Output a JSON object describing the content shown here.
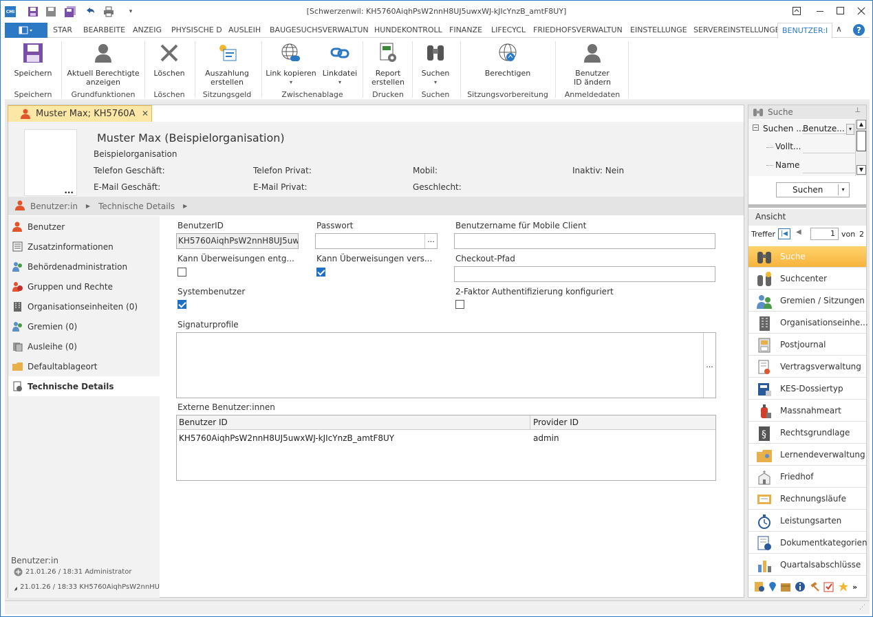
{
  "app": {
    "window_title": "[Schwerzenwil: KH5760AiqhPsW2nnH8UJ5uwxWJ-kJIcYnzB_amtF8UY]",
    "logo": "CMI"
  },
  "ribbon_tabs": [
    "STAR",
    "BEARBEITE",
    "ANZEIG",
    "PHYSISCHE D",
    "AUSLEIH",
    "BAUGESUCHSVERWALTUN",
    "HUNDEKONTROLL",
    "FINANZE",
    "LIFECYCL",
    "FRIEDHOFSVERWALTUN",
    "EINSTELLUNGE",
    "SERVEREINSTELLUNGE"
  ],
  "ribbon_active_tab": "BENUTZER:I",
  "ribbon": {
    "speichern": "Speichern",
    "aktuell_1": "Aktuell Berechtigte",
    "aktuell_2": "anzeigen",
    "loeschen": "Löschen",
    "auszahlung_1": "Auszahlung",
    "auszahlung_2": "erstellen",
    "link_kopieren": "Link kopieren",
    "linkdatei": "Linkdatei",
    "report_1": "Report",
    "report_2": "erstellen",
    "suchen": "Suchen",
    "berechtigen": "Berechtigen",
    "benutzer_1": "Benutzer",
    "benutzer_2": "ID ändern",
    "groups": {
      "speichern": "Speichern",
      "grundfunktionen": "Grundfunktionen",
      "loeschen": "Löschen",
      "sitzungsgeld": "Sitzungsgeld",
      "zwischenablage": "Zwischenablage",
      "drucken": "Drucken",
      "suchen": "Suchen",
      "sitzungsvorbereitung": "Sitzungsvorbereitung",
      "anmeldedaten": "Anmeldedaten"
    }
  },
  "doc_tab": "Muster Max; KH5760A",
  "header": {
    "name": "Muster Max (Beispielorganisation)",
    "org": "Beispielorganisation",
    "telefon_geschaeft": "Telefon Geschäft:",
    "telefon_privat": "Telefon Privat:",
    "mobil": "Mobil:",
    "inaktiv": "Inaktiv: Nein",
    "email_geschaeft": "E-Mail Geschäft:",
    "email_privat": "E-Mail Privat:",
    "geschlecht": "Geschlecht:"
  },
  "breadcrumb": [
    "Benutzer:in",
    "Technische Details"
  ],
  "nav": [
    "Benutzer",
    "Zusatzinformationen",
    "Behördenadministration",
    "Gruppen und Rechte",
    "Organisationseinheiten (0)",
    "Gremien (0)",
    "Ausleihe (0)",
    "Defaultablageort",
    "Technische Details"
  ],
  "nav_footer": {
    "title": "Benutzer:in",
    "created": "21.01.26 / 18:31 Administrator",
    "modified": "21.01.26 / 18:33 KH5760AiqhPsW2nnHU"
  },
  "form": {
    "benutzerid_label": "BenutzerID",
    "benutzerid_value": "KH5760AiqhPsW2nnH8UJ5uw:",
    "passwort_label": "Passwort",
    "mobile_label": "Benutzername für Mobile Client",
    "kann_entg_label": "Kann Überweisungen entg...",
    "kann_vers_label": "Kann Überweisungen vers...",
    "checkout_label": "Checkout-Pfad",
    "systembenutzer_label": "Systembenutzer",
    "twofa_label": "2-Faktor Authentifizierung konfiguriert",
    "signatur_label": "Signaturprofile",
    "extern_label": "Externe Benutzer:innen",
    "col_benutzer_id": "Benutzer ID",
    "col_provider_id": "Provider ID",
    "row_benutzer_id": "KH5760AiqhPsW2nnH8UJ5uwxWJ-kJIcYnzB_amtF8UY",
    "row_provider_id": "admin"
  },
  "right_panel": {
    "title": "Suche",
    "tree_root": "Suchen ...",
    "tree_root_value": "Benutze...",
    "tree_child1": "Vollt...",
    "tree_child2": "Name",
    "suchen_button": "Suchen",
    "ansicht": "Ansicht",
    "treffer": "Treffer",
    "page_value": "1",
    "von": "von",
    "total": "2",
    "buttons": [
      "Suche",
      "Suchcenter",
      "Gremien / Sitzungen",
      "Organisationseinhe...",
      "Postjournal",
      "Vertragsverwaltung",
      "KES-Dossiertyp",
      "Massnahmeart",
      "Rechtsgrundlage",
      "Lernendeverwaltung",
      "Friedhof",
      "Rechnungsläufe",
      "Leistungsarten",
      "Dokumentkategorien",
      "Quartalsabschlüsse"
    ]
  }
}
